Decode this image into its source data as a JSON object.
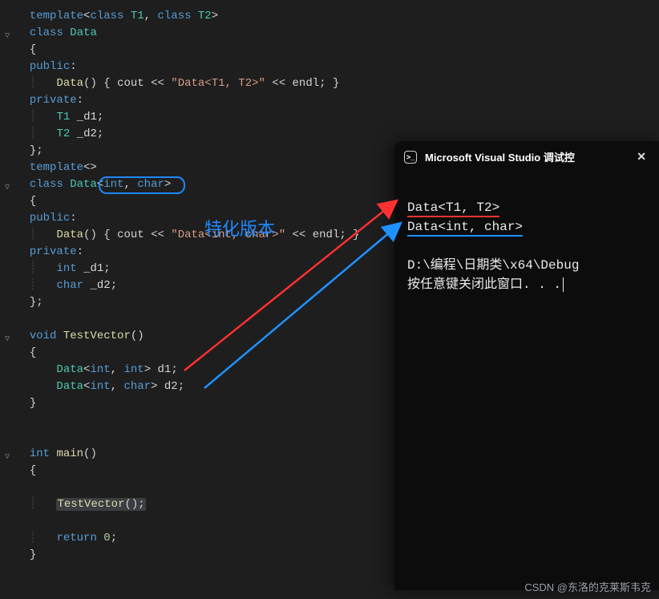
{
  "editor": {
    "l1_template": "template",
    "l1_class1": "class",
    "l1_T1": "T1",
    "l1_class2": "class",
    "l1_T2": "T2",
    "l2_class": "class",
    "l2_Data": "Data",
    "l4_public": "public",
    "l5_Data": "Data",
    "l5_cout": "cout",
    "l5_str": "\"Data<T1, T2>\"",
    "l5_endl": "endl",
    "l6_private": "private",
    "l7_T1": "T1",
    "l7_d1": "_d1",
    "l8_T2": "T2",
    "l8_d2": "_d2",
    "l10_template": "template",
    "l11_class": "class",
    "l11_Data": "Data",
    "l11_int": "int",
    "l11_char": "char",
    "l13_public": "public",
    "l14_Data": "Data",
    "l14_cout": "cout",
    "l14_str": "\"Data<int, char>\"",
    "l14_endl": "endl",
    "l15_private": "private",
    "l16_int": "int",
    "l16_d1": "_d1",
    "l17_char": "char",
    "l17_d2": "_d2",
    "l20_void": "void",
    "l20_TestVector": "TestVector",
    "l22_Data": "Data",
    "l22_int1": "int",
    "l22_int2": "int",
    "l22_d1": "d1",
    "l23_Data": "Data",
    "l23_int": "int",
    "l23_char": "char",
    "l23_d2": "d2",
    "l26_int": "int",
    "l26_main": "main",
    "l29_TestVector": "TestVector",
    "l31_return": "return",
    "l31_zero": "0"
  },
  "annotation": {
    "label": "特化版本"
  },
  "console": {
    "title": "Microsoft Visual Studio 调试控",
    "out1": "Data<T1, T2>",
    "out2": "Data<int, char>",
    "path": "D:\\编程\\日期类\\x64\\Debug",
    "prompt": "按任意键关闭此窗口. . ."
  },
  "watermark": "CSDN @东洛的克莱斯韦克"
}
